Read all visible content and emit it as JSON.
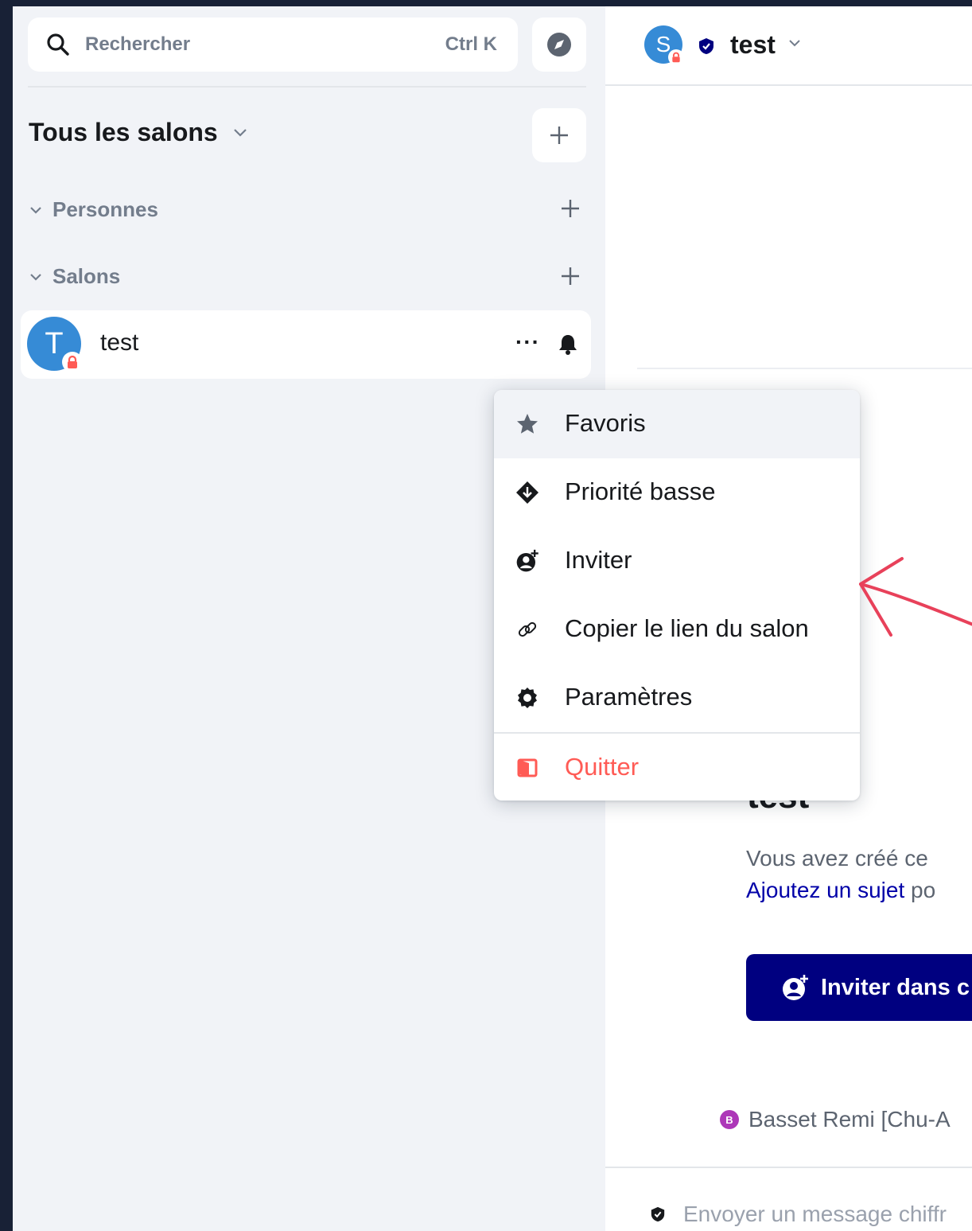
{
  "search": {
    "placeholder": "Rechercher",
    "shortcut": "Ctrl K"
  },
  "sidebar": {
    "title": "Tous les salons",
    "sections": [
      {
        "label": "Personnes"
      },
      {
        "label": "Salons"
      }
    ],
    "rooms": [
      {
        "name": "test",
        "avatar_letter": "T"
      }
    ]
  },
  "header": {
    "avatar_letter": "S",
    "room_name": "test"
  },
  "context_menu": {
    "items": [
      {
        "label": "Favoris",
        "icon": "star-icon"
      },
      {
        "label": "Priorité basse",
        "icon": "low-priority-icon"
      },
      {
        "label": "Inviter",
        "icon": "invite-user-icon"
      },
      {
        "label": "Copier le lien du salon",
        "icon": "link-icon"
      },
      {
        "label": "Paramètres",
        "icon": "settings-gear-icon"
      },
      {
        "label": "Quitter",
        "icon": "leave-door-icon"
      }
    ]
  },
  "main": {
    "room_title_partial": "test",
    "created_text": "Vous avez créé ce",
    "topic_link": "Ajoutez un sujet",
    "topic_suffix": " po",
    "invite_button": "Inviter dans c",
    "creator_letter": "B",
    "creator_text": "Basset Remi [Chu-A",
    "composer_placeholder": "Envoyer un message chiffr"
  },
  "colors": {
    "accent": "#000080",
    "avatar_blue": "#368bd6",
    "danger": "#ff5b55",
    "annotation_arrow": "#e8415a",
    "background_frame": "#182136"
  }
}
